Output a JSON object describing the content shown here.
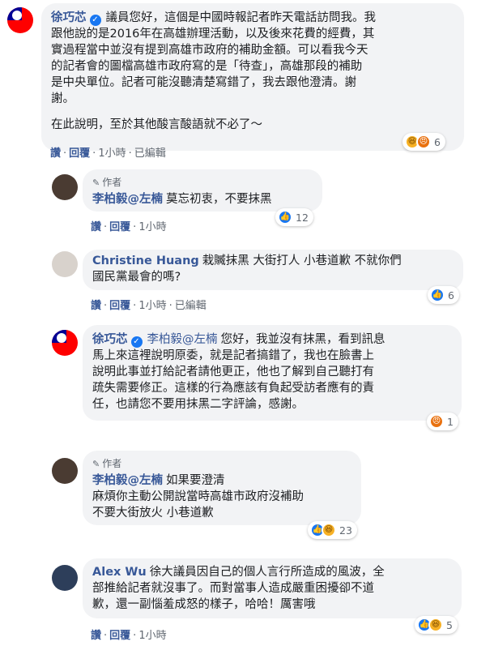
{
  "comments": [
    {
      "name": "徐巧芯",
      "verified": true,
      "lines": [
        "議員您好，這個是中國時報記者昨天電話訪問我。我",
        "跟他說的是2016年在高雄辦理活動，以及後來花費的經費，其",
        "實過程當中並沒有提到高雄市政府的補助金額。可以看我今天",
        "的記者會的圖檔高雄市政府寫的是「待查」，高雄那段的補助",
        "是中央單位。記者可能沒聽清楚寫錯了，我去跟他澄清。謝",
        "謝。"
      ],
      "extra_line": "在此說明，至於其他酸言酸語就不必了～",
      "actions": {
        "like": "讚",
        "reply": "回覆",
        "time": "1小時",
        "edited": "已編輯"
      },
      "reactions": {
        "count": "6",
        "icons": [
          "haha-icon",
          "angry-icon"
        ]
      }
    },
    {
      "author_tag": "作者",
      "name": "李柏毅@左楠",
      "text": "莫忘初衷，不要抹黑",
      "actions": {
        "like": "讚",
        "reply": "回覆",
        "time": "1小時"
      },
      "reactions": {
        "count": "12",
        "icons": [
          "like-icon"
        ]
      }
    },
    {
      "name": "Christine Huang",
      "lines": [
        "栽贓抹黑 大街打人 小巷道歉 不就你們",
        "國民黨最會的嗎?"
      ],
      "actions": {
        "like": "讚",
        "reply": "回覆",
        "time": "1小時",
        "edited": "已編輯"
      },
      "reactions": {
        "count": "6",
        "icons": [
          "like-icon"
        ]
      }
    },
    {
      "name": "徐巧芯",
      "verified": true,
      "mention": "李柏毅@左楠",
      "lines": [
        "您好，我並沒有抹黑，看到訊息",
        "馬上來這裡說明原委，就是記者搞錯了，我也在臉書上",
        "說明此事並打給記者請他更正，他也了解到自己聽打有",
        "疏失需要修正。這樣的行為應該有負起受訪者應有的責",
        "任，也請您不要用抹黑二字評論，感謝。"
      ],
      "reactions": {
        "count": "1",
        "icons": [
          "angry-icon"
        ]
      }
    },
    {
      "author_tag": "作者",
      "name": "李柏毅@左楠",
      "lines": [
        "如果要澄清",
        "麻煩你主動公開說當時高雄市政府沒補助",
        "不要大街放火 小巷道歉"
      ],
      "reactions": {
        "count": "23",
        "icons": [
          "like-icon",
          "haha-icon"
        ]
      }
    },
    {
      "name": "Alex Wu",
      "lines": [
        "徐大議員因自己的個人言行所造成的風波，全",
        "部推給記者就沒事了。而對當事人造成嚴重困擾卻不道",
        "歉，還一副惱羞成怒的樣子，哈哈！厲害哦"
      ],
      "actions": {
        "like": "讚",
        "reply": "回覆",
        "time": "1小時"
      },
      "reactions": {
        "count": "5",
        "icons": [
          "like-icon",
          "haha-icon"
        ]
      }
    }
  ],
  "colors": {
    "name": "#385898",
    "bubble": "#f2f3f5",
    "meta": "#606770",
    "like": "#1877f2",
    "haha": "#f7b125",
    "angry": "#e9710f"
  }
}
